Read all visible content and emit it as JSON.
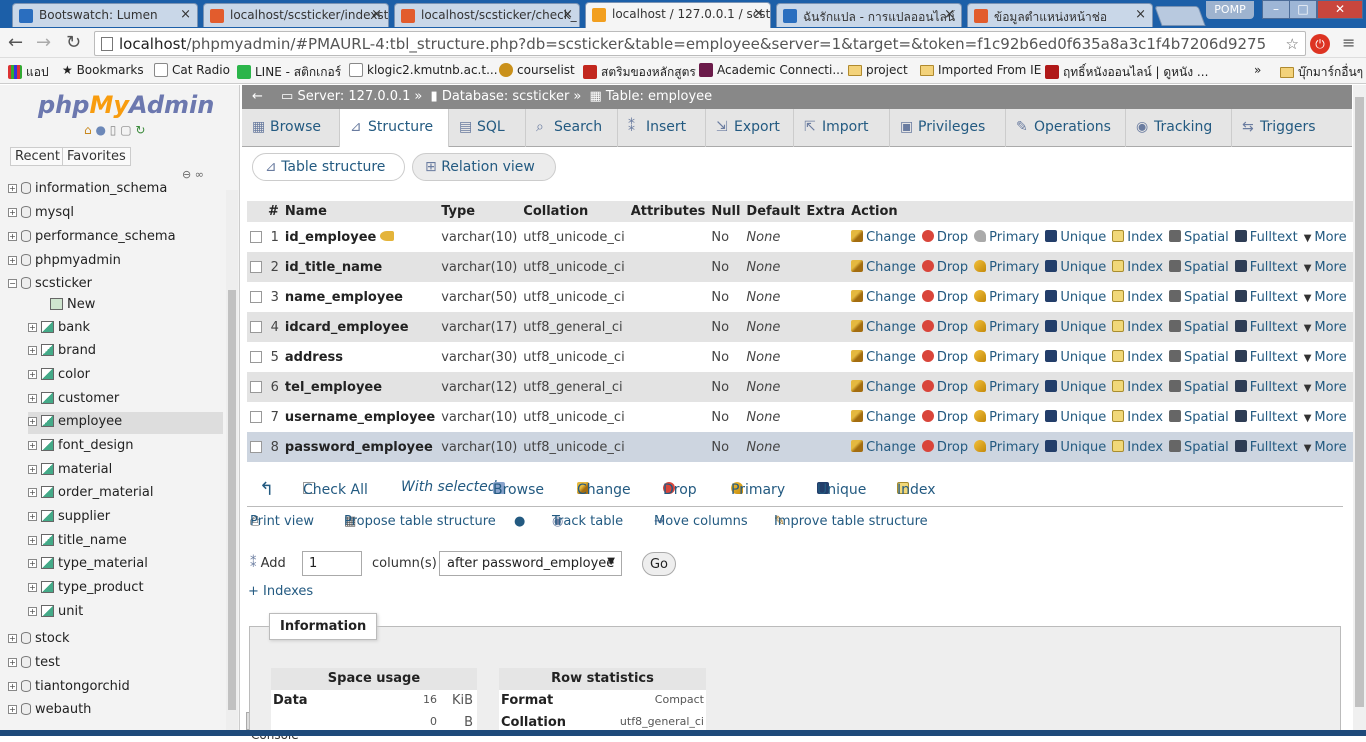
{
  "browser": {
    "tabs": [
      {
        "title": "Bootswatch: Lumen",
        "color": "#2a6ebf"
      },
      {
        "title": "localhost/scsticker/indexst",
        "color": "#e25c2d"
      },
      {
        "title": "localhost/scsticker/check_",
        "color": "#e25c2d"
      },
      {
        "title": "localhost / 127.0.0.1 / scst",
        "color": "#f29f1f"
      },
      {
        "title": "ฉันรักแปล - การแปลออนไลน์",
        "color": "#2a6ebf"
      },
      {
        "title": "ข้อมูลตำแหน่งหน้าช่อ",
        "color": "#e25c2d"
      }
    ],
    "profile": "POMP",
    "url_host": "localhost",
    "url_path": "/phpmyadmin/#PMAURL-4:tbl_structure.php?db=scsticker&table=employee&server=1&target=&token=f1c92b6ed0f635a8a3c1f4b7206d9275",
    "bookmarks": [
      "แอป",
      "Bookmarks",
      "Cat Radio",
      "LINE - สติกเกอร์",
      "klogic2.kmutnb.ac.t...",
      "courselist",
      "สตริมของหลักสูตร",
      "Academic Connecti...",
      "project",
      "Imported From IE",
      "ฤทธิ์หนังออนไลน์ | ดูหนัง ...",
      "»",
      "บุ๊กมาร์กอื่นๆ"
    ]
  },
  "nav": {
    "logo_php": "php",
    "logo_my": "My",
    "logo_admin": "Admin",
    "recent": "Recent",
    "favorites": "Favorites",
    "databases": [
      {
        "name": "information_schema"
      },
      {
        "name": "mysql"
      },
      {
        "name": "performance_schema"
      },
      {
        "name": "phpmyadmin"
      },
      {
        "name": "scsticker"
      }
    ],
    "new_label": "New",
    "tables": [
      "bank",
      "brand",
      "color",
      "customer",
      "employee",
      "font_design",
      "material",
      "order_material",
      "supplier",
      "title_name",
      "type_material",
      "type_product",
      "unit"
    ],
    "more_dbs": [
      "stock",
      "test",
      "tiantongorchid",
      "webauth"
    ],
    "console": "Console"
  },
  "breadcrumb": {
    "server": "Server: 127.0.0.1",
    "database": "Database: scsticker",
    "table": "Table: employee"
  },
  "main_tabs": [
    "Browse",
    "Structure",
    "SQL",
    "Search",
    "Insert",
    "Export",
    "Import",
    "Privileges",
    "Operations",
    "Tracking",
    "Triggers"
  ],
  "sub_tabs": [
    "Table structure",
    "Relation view"
  ],
  "columns_header": [
    "#",
    "Name",
    "Type",
    "Collation",
    "Attributes",
    "Null",
    "Default",
    "Extra",
    "Action"
  ],
  "rows": [
    {
      "num": "1",
      "name": "id_employee",
      "type": "varchar(10)",
      "collation": "utf8_unicode_ci",
      "null": "No",
      "default": "None"
    },
    {
      "num": "2",
      "name": "id_title_name",
      "type": "varchar(10)",
      "collation": "utf8_unicode_ci",
      "null": "No",
      "default": "None"
    },
    {
      "num": "3",
      "name": "name_employee",
      "type": "varchar(50)",
      "collation": "utf8_unicode_ci",
      "null": "No",
      "default": "None"
    },
    {
      "num": "4",
      "name": "idcard_employee",
      "type": "varchar(17)",
      "collation": "utf8_general_ci",
      "null": "No",
      "default": "None"
    },
    {
      "num": "5",
      "name": "address",
      "type": "varchar(30)",
      "collation": "utf8_unicode_ci",
      "null": "No",
      "default": "None"
    },
    {
      "num": "6",
      "name": "tel_employee",
      "type": "varchar(12)",
      "collation": "utf8_general_ci",
      "null": "No",
      "default": "None"
    },
    {
      "num": "7",
      "name": "username_employee",
      "type": "varchar(10)",
      "collation": "utf8_unicode_ci",
      "null": "No",
      "default": "None"
    },
    {
      "num": "8",
      "name": "password_employee",
      "type": "varchar(10)",
      "collation": "utf8_unicode_ci",
      "null": "No",
      "default": "None"
    }
  ],
  "row_actions": [
    "Change",
    "Drop",
    "Primary",
    "Unique",
    "Index",
    "Spatial",
    "Fulltext",
    "More"
  ],
  "with_selected": {
    "check_all": "Check All",
    "label": "With selected:",
    "actions": [
      "Browse",
      "Change",
      "Drop",
      "Primary",
      "Unique",
      "Index"
    ]
  },
  "links": [
    "Print view",
    "Propose table structure",
    "Track table",
    "Move columns",
    "Improve table structure"
  ],
  "add": {
    "label": "Add",
    "count": "1",
    "unit": "column(s)",
    "position": "after password_employee",
    "go": "Go"
  },
  "indexes": "+ Indexes",
  "information": {
    "legend": "Information",
    "space_usage": {
      "title": "Space usage",
      "rows": [
        {
          "key": "Data",
          "value": "16",
          "unit": "KiB"
        },
        {
          "key": "",
          "value": "0",
          "unit": "B"
        }
      ]
    },
    "row_stats": {
      "title": "Row statistics",
      "rows": [
        {
          "key": "Format",
          "value": "Compact"
        },
        {
          "key": "Collation",
          "value": "utf8_general_ci"
        }
      ]
    }
  }
}
